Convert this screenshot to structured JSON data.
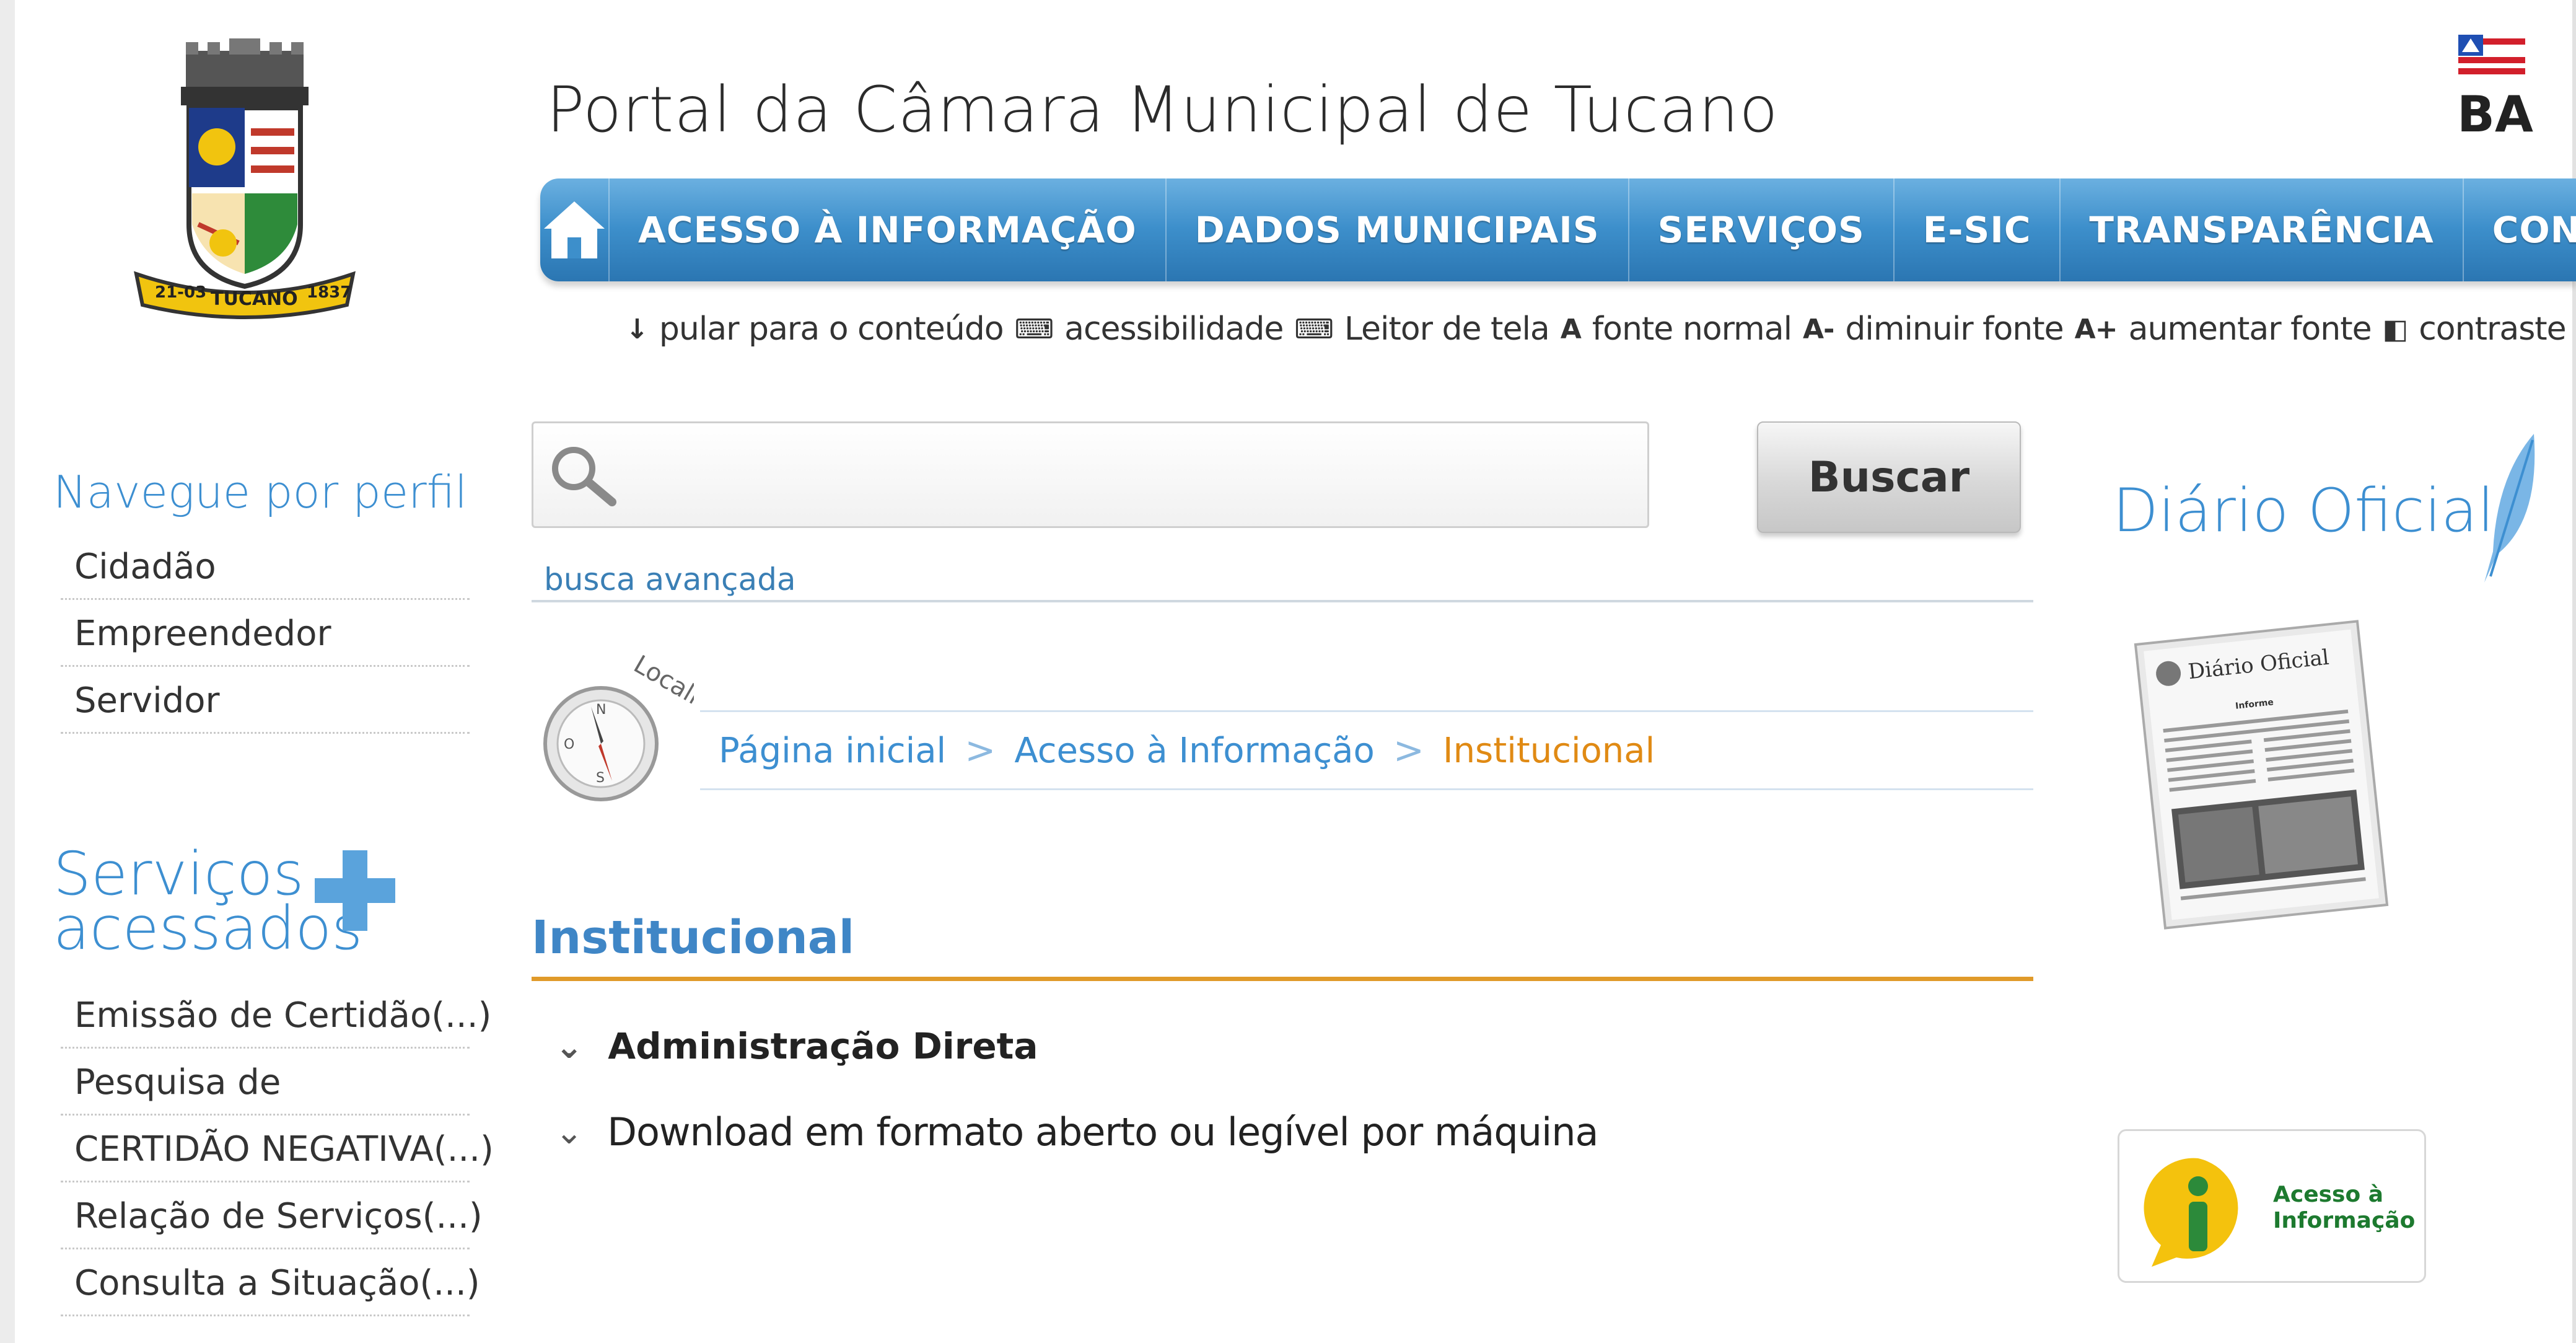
{
  "header": {
    "title": "Portal da Câmara Municipal de Tucano",
    "state_badge": "BA",
    "crest_text": {
      "top_left": "21-03",
      "center": "TUCANO",
      "top_right": "1837"
    }
  },
  "nav": {
    "home_icon": "home-icon",
    "items": [
      "ACESSO À INFORMAÇÃO",
      "DADOS MUNICIPAIS",
      "SERVIÇOS",
      "E-SIC",
      "TRANSPARÊNCIA",
      "CONTATO"
    ],
    "color": "#3d8fcb"
  },
  "accessibility": {
    "skip": "pular para o conteúdo",
    "access": "acessibilidade",
    "reader": "Leitor de tela",
    "normal": "fonte normal",
    "smaller": "diminuir fonte",
    "bigger": "aumentar fonte",
    "contrast": "contraste",
    "icons": {
      "normal": "A",
      "smaller": "A-",
      "bigger": "A+"
    }
  },
  "sidebar": {
    "profile_title": "Navegue por perfil",
    "profile_items": [
      "Cidadão",
      "Empreendedor",
      "Servidor"
    ],
    "services_title_1": "Serviços",
    "services_title_2": "acessados",
    "service_items": [
      "Emissão de Certidão(...)",
      "Pesquisa de",
      "CERTIDÃO NEGATIVA(...)",
      "Relação de Serviços(...)",
      "Consulta a Situação(...)"
    ]
  },
  "search": {
    "placeholder": "",
    "button": "Buscar",
    "advanced": "busca avançada"
  },
  "breadcrumb": {
    "badge": "Localize-se",
    "items": [
      "Página inicial",
      "Acesso à Informação",
      "Institucional"
    ],
    "separator": ">"
  },
  "content": {
    "title": "Institucional",
    "sections": [
      "Administração Direta",
      "Download em formato aberto ou legível por máquina"
    ]
  },
  "right": {
    "diario_title": "Diário Oficial",
    "newspaper_title": "Diário Oficial",
    "newspaper_heading": "Informe",
    "acesso_label_1": "Acesso à",
    "acesso_label_2": "Informação"
  },
  "colors": {
    "accent": "#3d8fd1",
    "orange": "#e08a14",
    "rule": "#e09a2a"
  }
}
